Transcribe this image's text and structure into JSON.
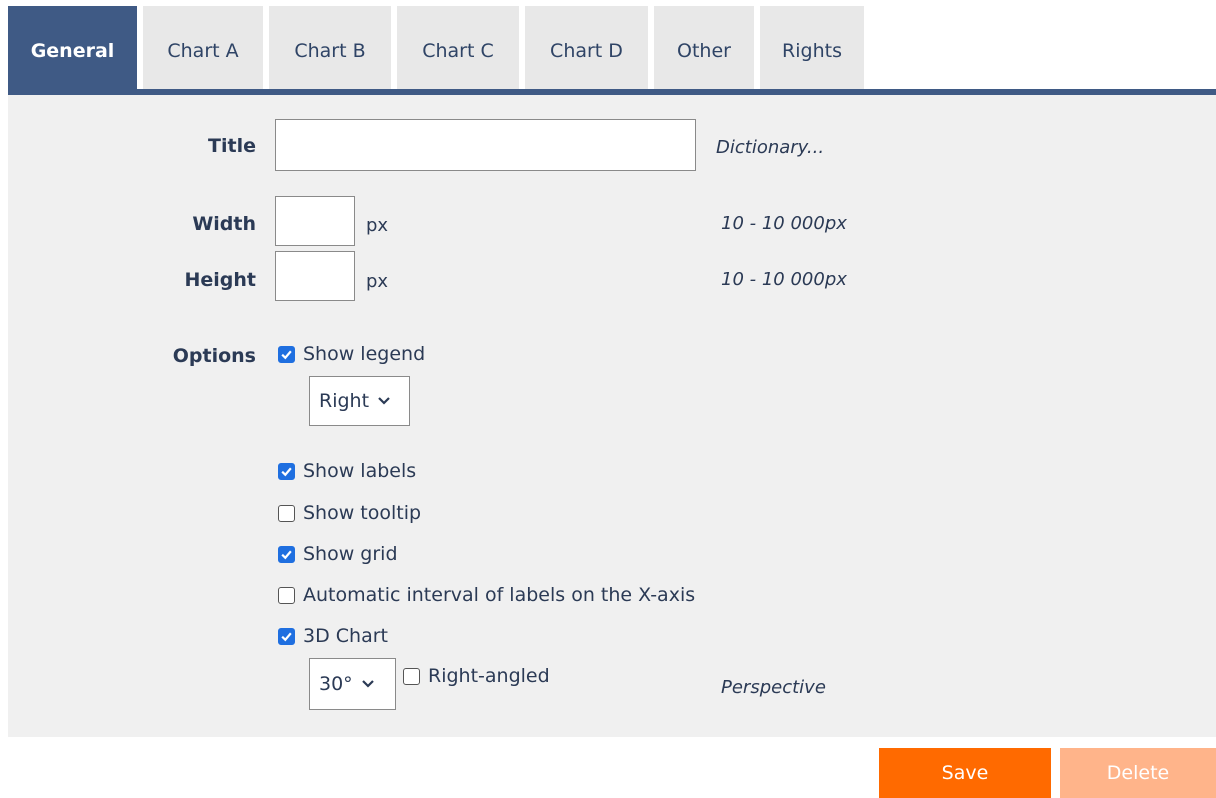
{
  "tabs": [
    {
      "label": "General",
      "active": true
    },
    {
      "label": "Chart A",
      "active": false
    },
    {
      "label": "Chart B",
      "active": false
    },
    {
      "label": "Chart C",
      "active": false
    },
    {
      "label": "Chart D",
      "active": false
    },
    {
      "label": "Other",
      "active": false
    },
    {
      "label": "Rights",
      "active": false
    }
  ],
  "form": {
    "title": {
      "label": "Title",
      "value": "",
      "hint": "Dictionary..."
    },
    "width": {
      "label": "Width",
      "value": "",
      "unit": "px",
      "hint": "10 - 10 000px"
    },
    "height": {
      "label": "Height",
      "value": "",
      "unit": "px",
      "hint": "10 - 10 000px"
    },
    "options": {
      "label": "Options",
      "show_legend": {
        "label": "Show legend",
        "checked": true
      },
      "legend_position": {
        "selected": "Right"
      },
      "show_labels": {
        "label": "Show labels",
        "checked": true
      },
      "show_tooltip": {
        "label": "Show tooltip",
        "checked": false
      },
      "show_grid": {
        "label": "Show grid",
        "checked": true
      },
      "auto_interval": {
        "label": "Automatic interval of labels on the X-axis",
        "checked": false
      },
      "chart_3d": {
        "label": "3D Chart",
        "checked": true
      },
      "angle": {
        "selected": "30°"
      },
      "right_angled": {
        "label": "Right-angled",
        "checked": false
      },
      "perspective_hint": "Perspective"
    }
  },
  "buttons": {
    "save": "Save",
    "delete": "Delete"
  },
  "colors": {
    "accent": "#3f5a85",
    "save": "#ff6a00",
    "delete": "#ffb48a",
    "checkbox": "#1f6fe0"
  }
}
